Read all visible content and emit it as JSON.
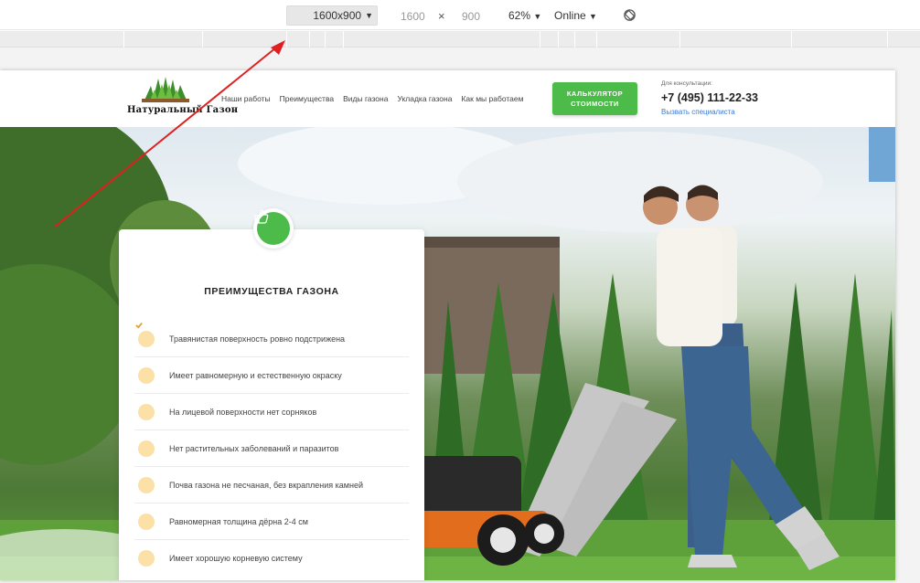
{
  "devtools": {
    "preset": "1600x900",
    "width": "1600",
    "height": "900",
    "times": "×",
    "zoom": "62%",
    "network": "Online",
    "icons": [
      "caret-down-icon",
      "rotate-icon"
    ]
  },
  "header": {
    "logo_text": "Натуральный Газон",
    "nav": [
      "Наши работы",
      "Преимущества",
      "Виды газона",
      "Укладка газона",
      "Как мы работаем"
    ],
    "calc_button": "КАЛЬКУЛЯТОР СТОИМОСТИ",
    "consult_label": "Для консультации:",
    "phone": "+7 (495) 111-22-33",
    "call_link": "Вызвать специалиста"
  },
  "card": {
    "title": "ПРЕИМУЩЕСТВА ГАЗОНА",
    "icon": "thumbs-up-icon",
    "items": [
      "Травянистая поверхность ровно подстрижена",
      "Имеет равномерную и естественную окраску",
      "На лицевой поверхности нет сорняков",
      "Нет растительных заболеваний и паразитов",
      "Почва газона не песчаная, без вкрапления камней",
      "Равномерная толщина дёрна 2-4 см",
      "Имеет хорошую корневую систему"
    ]
  },
  "colors": {
    "accent_green": "#4dbb49",
    "check_bg": "#fbe0a8",
    "link_blue": "#3a7bd5",
    "arrow_red": "#e02020"
  }
}
